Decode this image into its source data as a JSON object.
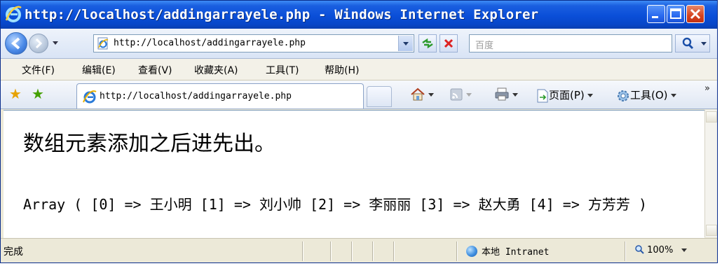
{
  "window": {
    "title": "http://localhost/addingarrayele.php - Windows Internet Explorer"
  },
  "address_bar": {
    "url": "http://localhost/addingarrayele.php"
  },
  "search": {
    "placeholder": "百度"
  },
  "menu": {
    "items": [
      "文件(F)",
      "编辑(E)",
      "查看(V)",
      "收藏夹(A)",
      "工具(T)",
      "帮助(H)"
    ]
  },
  "tab": {
    "label": "http://localhost/addingarrayele.php"
  },
  "command_bar": {
    "page_label": "页面(P)",
    "tools_label": "工具(O)"
  },
  "content": {
    "heading": "数组元素添加之后进先出。",
    "output": "Array ( [0] => 王小明 [1] => 刘小帅 [2] => 李丽丽 [3] => 赵大勇 [4] => 方芳芳 )"
  },
  "status": {
    "text": "完成",
    "zone": "本地 Intranet",
    "zoom": "100%"
  },
  "colors": {
    "titlebar": "#0a4ed8",
    "close_button": "#d5431f"
  }
}
